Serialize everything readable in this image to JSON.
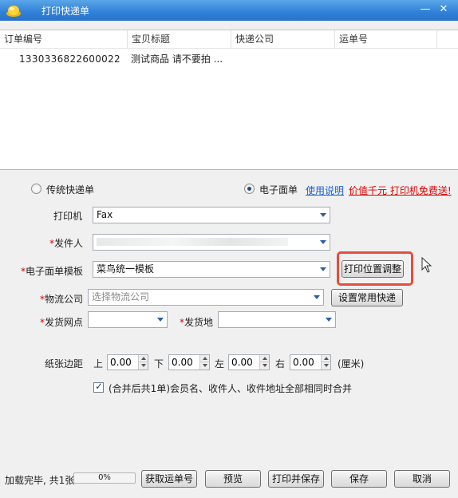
{
  "window": {
    "title": "打印快递单",
    "minimize": "—",
    "close": "✕"
  },
  "list": {
    "columns": [
      "订单编号",
      "宝贝标题",
      "快递公司",
      "运单号"
    ],
    "rows": [
      {
        "order_no": "1330336822600022",
        "title": "测试商品  请不要拍 ...",
        "company": "",
        "waybill": ""
      }
    ]
  },
  "mode": {
    "traditional_label": "传统快递单",
    "electronic_label": "电子面单",
    "selected": "电子面单",
    "help_link": "使用说明",
    "promo": "价值千元  打印机免费送!"
  },
  "form": {
    "printer_label": "打印机",
    "printer_value": "Fax",
    "sender_label": "发件人",
    "sender_value": "",
    "template_label": "电子面单模板",
    "template_value": "菜鸟统一模板",
    "adjust_button": "打印位置调整",
    "logistics_label": "物流公司",
    "logistics_placeholder": "选择物流公司",
    "common_button": "设置常用快递",
    "outlet_label": "发货网点",
    "outlet_value": "",
    "origin_label": "发货地",
    "origin_value": "",
    "margin_label": "纸张边距",
    "top_label": "上",
    "top_value": "0.00",
    "bottom_label": "下",
    "bottom_value": "0.00",
    "left_label": "左",
    "left_value": "0.00",
    "right_label": "右",
    "right_value": "0.00",
    "unit": "(厘米)",
    "merge_checked": true,
    "merge_label": "(合并后共1单)会员名、收件人、收件地址全部相同时合并",
    "required_mark": "*"
  },
  "status": {
    "text": "加载完毕, 共1张",
    "progress_percent": 0,
    "progress_text": "0%"
  },
  "buttons": {
    "get_waybill": "获取运单号",
    "preview": "预览",
    "print_save": "打印并保存",
    "save": "保存",
    "cancel": "取消"
  },
  "colors": {
    "titlebar": "#2f80d8",
    "required": "#e20000",
    "link": "#1a5fd0",
    "highlight": "#e74c3c"
  }
}
